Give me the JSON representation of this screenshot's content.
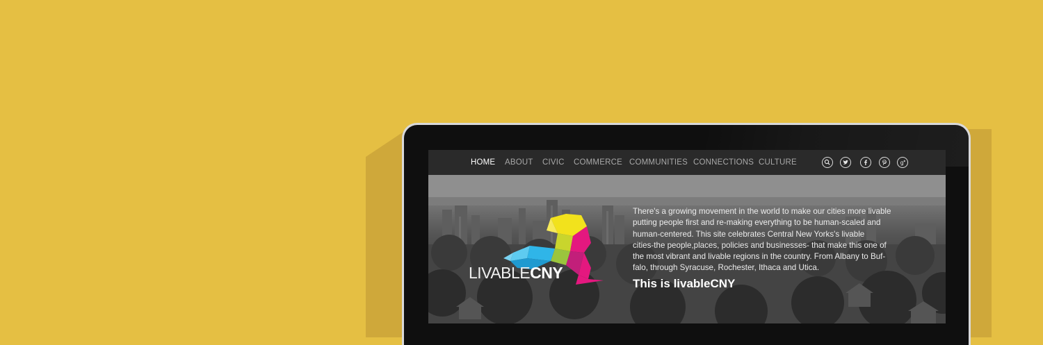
{
  "nav": {
    "items": [
      {
        "label": "HOME",
        "active": true
      },
      {
        "label": "ABOUT",
        "active": false
      },
      {
        "label": "CIVIC",
        "active": false
      },
      {
        "label": "COMMERCE",
        "active": false
      },
      {
        "label": "COMMUNITIES",
        "active": false
      },
      {
        "label": "CONNECTIONS",
        "active": false
      },
      {
        "label": "CULTURE",
        "active": false
      }
    ],
    "icons": [
      "search-icon",
      "twitter-icon",
      "facebook-icon",
      "pinterest-icon",
      "google-plus-icon"
    ]
  },
  "hero": {
    "logo": {
      "thin": "LIVABLE",
      "bold": "CNY"
    },
    "lines": [
      "There's a growing movement in the world to make our cities more livable",
      "putting people first and re-making everything to be human-scaled and",
      "human-centered. This site celebrates Central New Yorks's livable",
      "cities-the people,places, policies and businesses- that make this one of",
      "the most vibrant and livable regions in the country. From Albany to Buf-",
      "falo, through Syracuse, Rochester, Ithaca and Utica."
    ],
    "tagline": "This is livableCNY"
  },
  "colors": {
    "background": "#e5bf43",
    "nav_bg": "#2a2a2a",
    "logo_yellow": "#f2e21c",
    "logo_green": "#9bc53d",
    "logo_blue": "#2fb5e8",
    "logo_magenta": "#e4187f"
  }
}
